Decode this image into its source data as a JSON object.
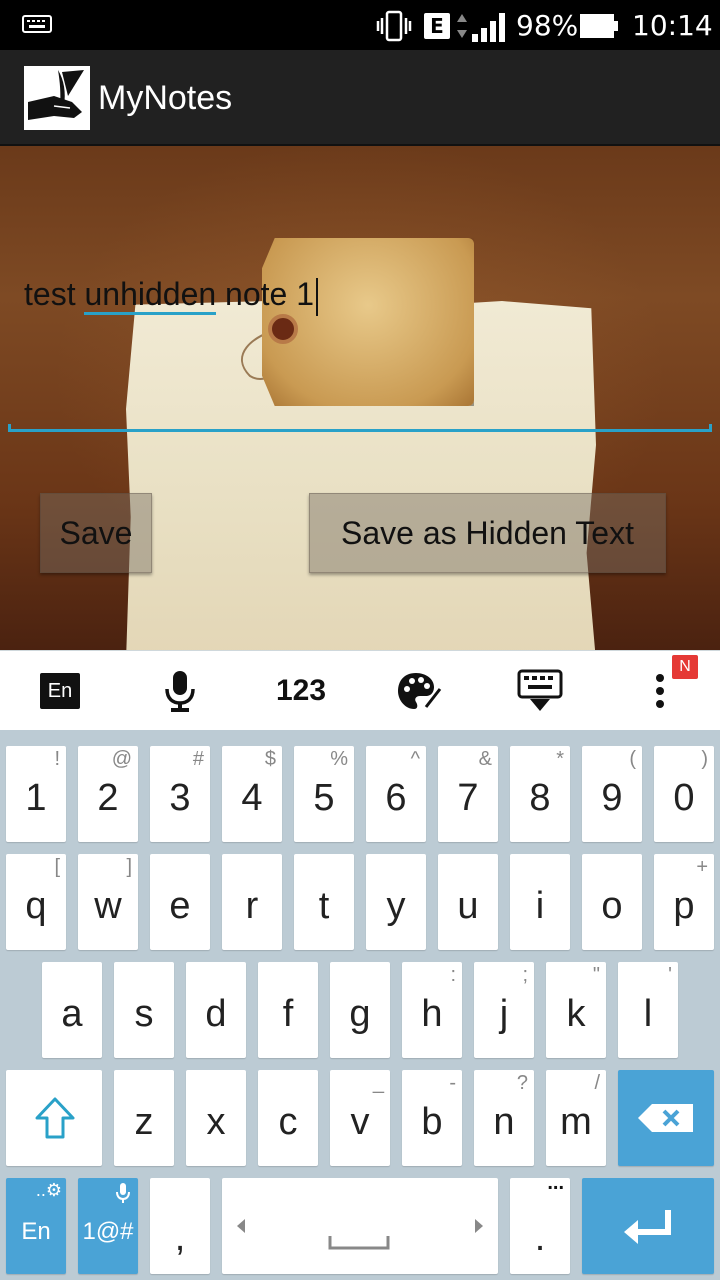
{
  "status_bar": {
    "battery_percent": "98%",
    "network_type": "E",
    "time": "10:14",
    "icons": [
      "keyboard-icon",
      "vibrate-icon",
      "network-type-icon",
      "signal-icon",
      "battery-icon"
    ]
  },
  "app": {
    "title": "MyNotes",
    "logo_icon": "hand-quill-icon"
  },
  "editor": {
    "text_before": "test ",
    "text_underlined": "unhidden",
    "text_after": " note 1",
    "accent_color": "#29a1c8"
  },
  "buttons": {
    "save": "Save",
    "save_hidden": "Save as Hidden Text"
  },
  "keyboard_toolbar": {
    "language": "En",
    "numbers": "123",
    "badge": "N",
    "icons": [
      "language-icon",
      "microphone-icon",
      "numbers-icon",
      "palette-icon",
      "hide-keyboard-icon",
      "more-menu-icon"
    ]
  },
  "keyboard": {
    "row1": [
      {
        "key": "1",
        "hint": "!"
      },
      {
        "key": "2",
        "hint": "@"
      },
      {
        "key": "3",
        "hint": "#"
      },
      {
        "key": "4",
        "hint": "$"
      },
      {
        "key": "5",
        "hint": "%"
      },
      {
        "key": "6",
        "hint": "^"
      },
      {
        "key": "7",
        "hint": "&"
      },
      {
        "key": "8",
        "hint": "*"
      },
      {
        "key": "9",
        "hint": "("
      },
      {
        "key": "0",
        "hint": ")"
      }
    ],
    "row2": [
      {
        "key": "q",
        "hint": "["
      },
      {
        "key": "w",
        "hint": "]"
      },
      {
        "key": "e",
        "hint": ""
      },
      {
        "key": "r",
        "hint": ""
      },
      {
        "key": "t",
        "hint": ""
      },
      {
        "key": "y",
        "hint": ""
      },
      {
        "key": "u",
        "hint": ""
      },
      {
        "key": "i",
        "hint": ""
      },
      {
        "key": "o",
        "hint": ""
      },
      {
        "key": "p",
        "hint": "+"
      }
    ],
    "row3": [
      {
        "key": "a",
        "hint": ""
      },
      {
        "key": "s",
        "hint": ""
      },
      {
        "key": "d",
        "hint": ""
      },
      {
        "key": "f",
        "hint": ""
      },
      {
        "key": "g",
        "hint": ""
      },
      {
        "key": "h",
        "hint": ":"
      },
      {
        "key": "j",
        "hint": ";"
      },
      {
        "key": "k",
        "hint": "\""
      },
      {
        "key": "l",
        "hint": "'"
      }
    ],
    "row4": [
      {
        "key": "z",
        "hint": ""
      },
      {
        "key": "x",
        "hint": ""
      },
      {
        "key": "c",
        "hint": ""
      },
      {
        "key": "v",
        "hint": "_"
      },
      {
        "key": "b",
        "hint": "-"
      },
      {
        "key": "n",
        "hint": "?"
      },
      {
        "key": "m",
        "hint": "/"
      }
    ],
    "row5": {
      "lang": "En",
      "symbols": "1@#",
      "comma": ",",
      "period": ".",
      "period_hint": "..."
    },
    "key_color": "#ffffff",
    "action_key_color": "#4aa3d6",
    "background_color": "#bccbd4"
  }
}
